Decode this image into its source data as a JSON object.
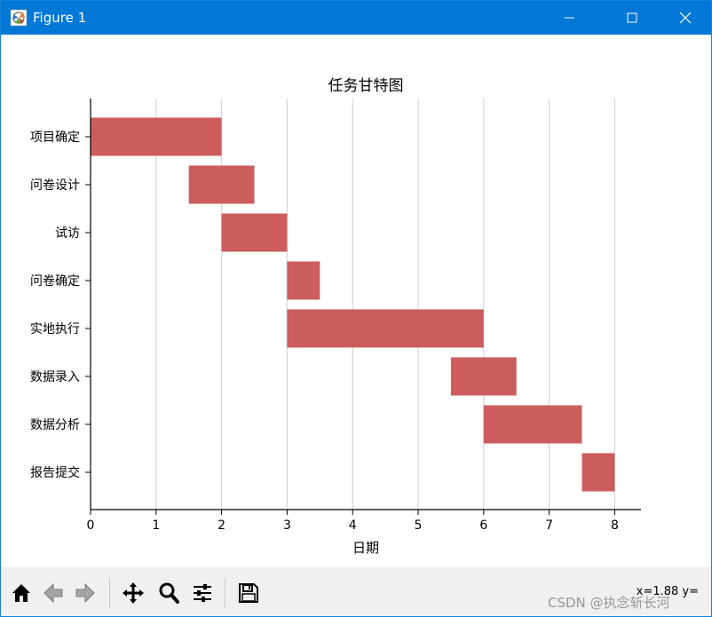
{
  "window": {
    "title": "Figure 1",
    "titlebar_color": "#0078d7"
  },
  "toolbar": {
    "buttons": [
      {
        "name": "home-icon"
      },
      {
        "name": "back-arrow-icon"
      },
      {
        "name": "forward-arrow-icon"
      },
      {
        "name": "pan-icon"
      },
      {
        "name": "zoom-icon"
      },
      {
        "name": "configure-subplots-icon"
      },
      {
        "name": "save-icon"
      }
    ],
    "coordinate_readout": "x=1.88 y="
  },
  "watermark": "CSDN @执念斩长河",
  "chart_data": {
    "type": "gantt",
    "title": "任务甘特图",
    "xlabel": "日期",
    "ylabel": "",
    "xlim": [
      0,
      8.4
    ],
    "xticks": [
      0,
      1,
      2,
      3,
      4,
      5,
      6,
      7,
      8
    ],
    "grid": "vertical",
    "bar_color": "#cd5c5c",
    "tasks": [
      {
        "name": "项目确定",
        "start": 0,
        "end": 2
      },
      {
        "name": "问卷设计",
        "start": 1.5,
        "end": 2.5
      },
      {
        "name": "试访",
        "start": 2,
        "end": 3
      },
      {
        "name": "问卷确定",
        "start": 3,
        "end": 3.5
      },
      {
        "name": "实地执行",
        "start": 3,
        "end": 6
      },
      {
        "name": "数据录入",
        "start": 5.5,
        "end": 6.5
      },
      {
        "name": "数据分析",
        "start": 6,
        "end": 7.5
      },
      {
        "name": "报告提交",
        "start": 7.5,
        "end": 8
      }
    ]
  }
}
